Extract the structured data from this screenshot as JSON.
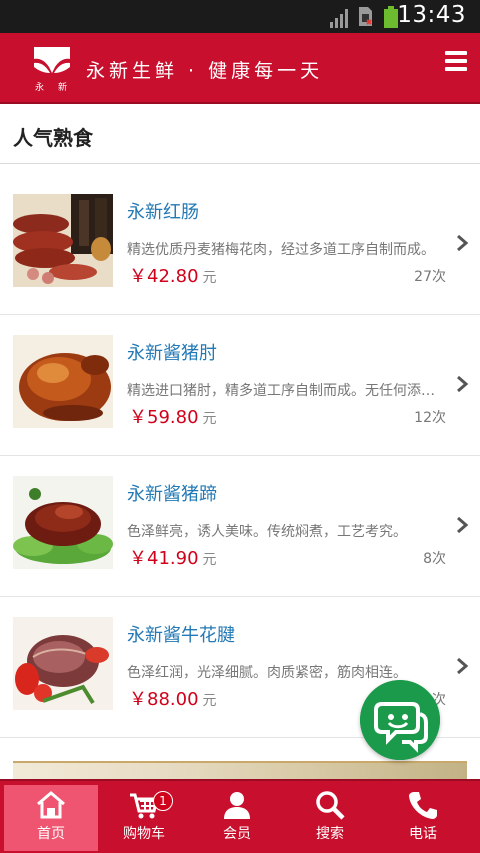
{
  "status_bar": {
    "time": "13:43"
  },
  "header": {
    "logo_text": "永 新",
    "slogan": "永新生鲜 · 健康每一天",
    "brand_color": "#c8102e"
  },
  "section": {
    "title": "人气熟食"
  },
  "products": [
    {
      "name": "永新红肠",
      "desc": "精选优质丹麦猪梅花肉，经过多道工序自制而成。",
      "price": "￥42.80",
      "unit": "元",
      "count": "27次"
    },
    {
      "name": "永新酱猪肘",
      "desc": "精选进口猪肘，精多道工序自制而成。无任何添加。",
      "price": "￥59.80",
      "unit": "元",
      "count": "12次"
    },
    {
      "name": "永新酱猪蹄",
      "desc": "色泽鲜亮，诱人美味。传统焖煮，工艺考究。",
      "price": "￥41.90",
      "unit": "元",
      "count": "8次"
    },
    {
      "name": "永新酱牛花腱",
      "desc": "色泽红润，光泽细腻。肉质紧密，筋肉相连。",
      "price": "￥88.00",
      "unit": "元",
      "count": "次"
    }
  ],
  "tab_bar": {
    "tabs": [
      {
        "label": "首页",
        "icon": "home-icon"
      },
      {
        "label": "购物车",
        "icon": "cart-icon",
        "badge": "1"
      },
      {
        "label": "会员",
        "icon": "member-icon"
      },
      {
        "label": "搜索",
        "icon": "search-icon"
      },
      {
        "label": "电话",
        "icon": "phone-icon"
      }
    ]
  },
  "colors": {
    "accent": "#c8102e",
    "price": "#d0021b",
    "link": "#2379b5",
    "chat": "#1a9a4a"
  }
}
